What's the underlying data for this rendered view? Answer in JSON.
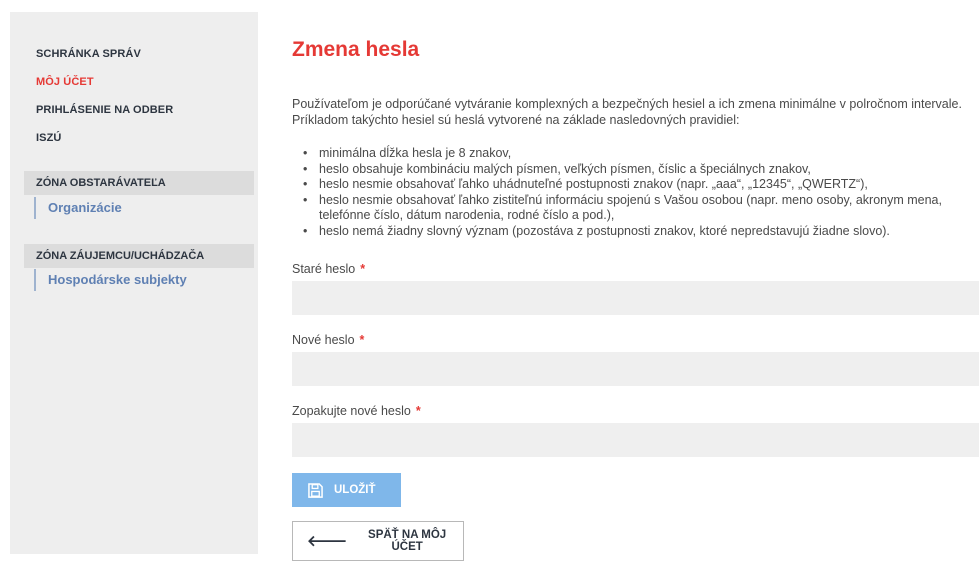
{
  "sidebar": {
    "links": [
      {
        "label": "SCHRÁNKA SPRÁV",
        "active": false
      },
      {
        "label": "MÔJ ÚČET",
        "active": true
      },
      {
        "label": "PRIHLÁSENIE NA ODBER",
        "active": false
      },
      {
        "label": "ISZÚ",
        "active": false
      }
    ],
    "zones": [
      {
        "heading": "ZÓNA OBSTARÁVATEĽA",
        "items": [
          "Organizácie"
        ]
      },
      {
        "heading": "ZÓNA ZÁUJEMCU/UCHÁDZAČA",
        "items": [
          "Hospodárske subjekty"
        ]
      }
    ]
  },
  "page": {
    "title": "Zmena hesla",
    "intro": "Používateľom je odporúčané vytváranie komplexných a bezpečných hesiel a ich zmena minimálne v polročnom intervale. Príkladom takýchto hesiel sú heslá vytvorené na základe nasledovných pravidiel:",
    "rules": [
      "minimálna dĺžka hesla je 8 znakov,",
      "heslo obsahuje kombináciu malých písmen, veľkých písmen, číslic a špeciálnych znakov,",
      "heslo nesmie obsahovať ľahko uhádnuteľné postupnosti znakov (napr. „aaa“, „12345“, „QWERTZ“),",
      "heslo nesmie obsahovať ľahko zistiteľnú informáciu spojenú s Vašou osobou (napr. meno osoby, akronym mena, telefónne číslo, dátum narodenia, rodné číslo a pod.),",
      "heslo nemá žiadny slovný význam (pozostáva z postupnosti znakov, ktoré nepredstavujú žiadne slovo)."
    ]
  },
  "form": {
    "old_password": {
      "label": "Staré heslo",
      "required_mark": "*",
      "value": ""
    },
    "new_password": {
      "label": "Nové heslo",
      "required_mark": "*",
      "value": ""
    },
    "repeat_password": {
      "label": "Zopakujte nové heslo",
      "required_mark": "*",
      "value": ""
    },
    "save_label": "ULOŽIŤ",
    "back_label": "SPÄŤ NA MÔJ ÚČET"
  },
  "icons": {
    "save": "floppy-disk-icon",
    "back": "arrow-left-icon"
  },
  "colors": {
    "accent": "#e53935",
    "link": "#5f80b3",
    "save_button": "#7fb7ea",
    "field_bg": "#efefef",
    "sidebar_bg": "#eeeeee"
  }
}
